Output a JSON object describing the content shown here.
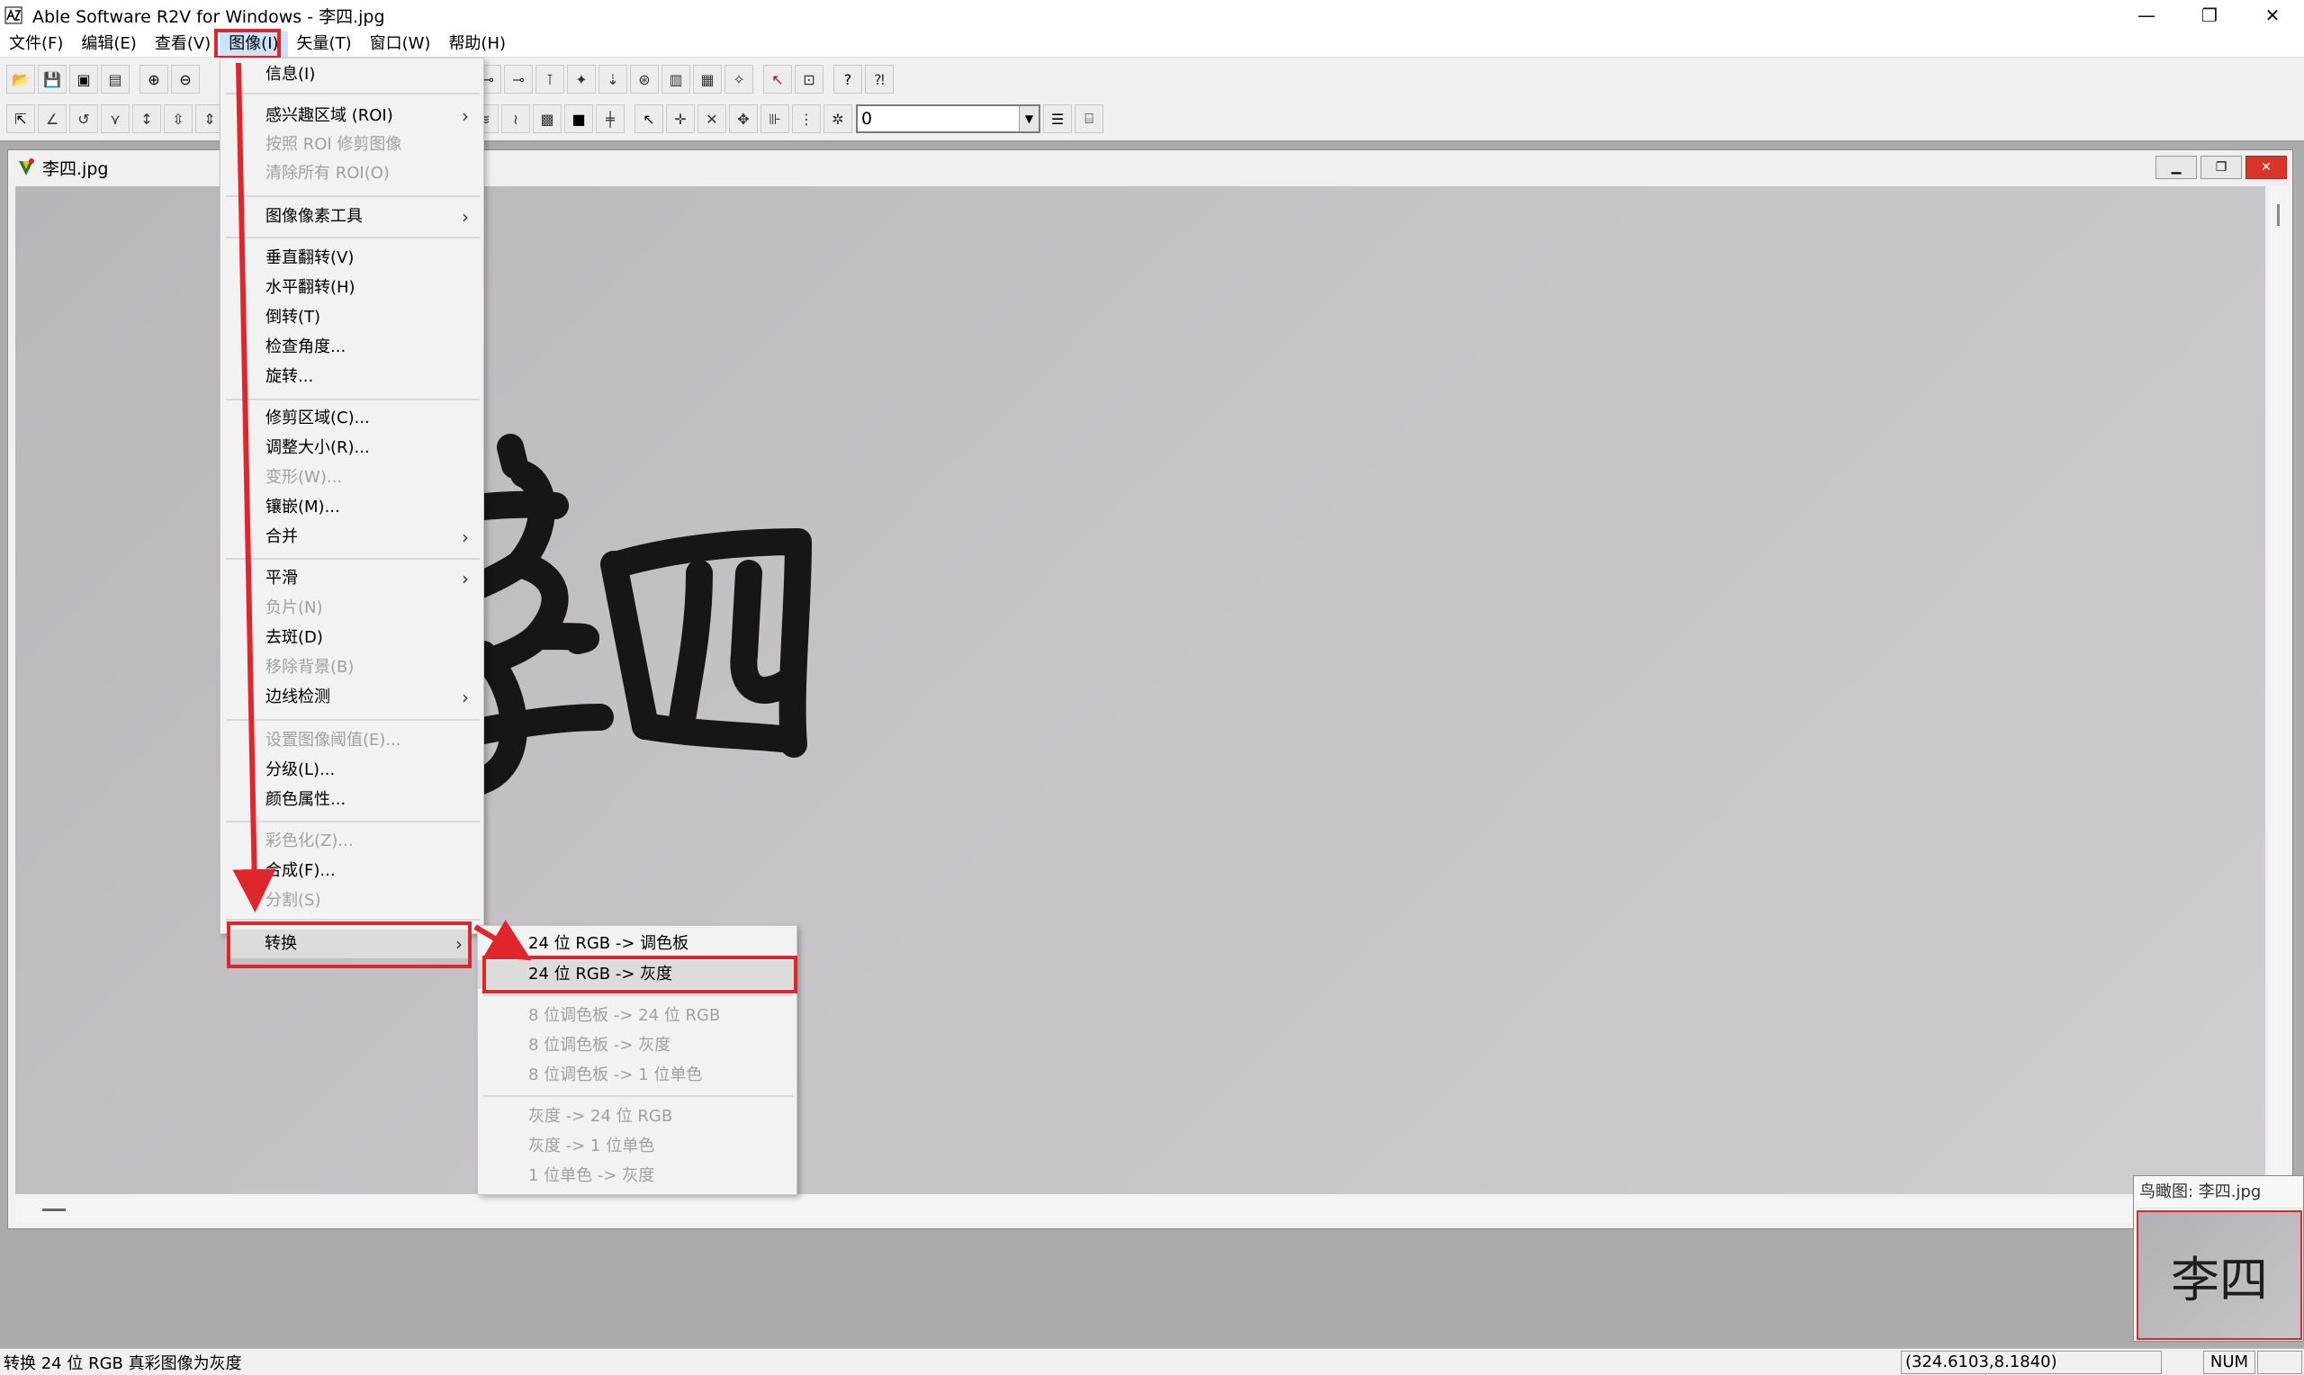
{
  "window": {
    "title": "Able Software R2V for Windows - 李四.jpg",
    "controls": {
      "minimize": "—",
      "restore": "❐",
      "close": "✕"
    }
  },
  "menubar": {
    "items": [
      "文件(F)",
      "编辑(E)",
      "查看(V)",
      "图像(I)",
      "矢量(T)",
      "窗口(W)",
      "帮助(H)"
    ],
    "active": "图像(I)"
  },
  "toolbar": {
    "row1_icons": [
      "open-icon",
      "save-icon",
      "save-all-icon",
      "print-icon",
      "zoom-in-icon",
      "zoom-out-icon"
    ],
    "line_width_value": "0"
  },
  "document": {
    "name": "李四.jpg",
    "image_text": "李四"
  },
  "image_menu": {
    "items": [
      {
        "label": "信息(I)",
        "enabled": true,
        "submenu": false
      },
      {
        "label": "感兴趣区域 (ROI)",
        "enabled": true,
        "submenu": true
      },
      {
        "label": "按照 ROI 修剪图像",
        "enabled": false,
        "submenu": false
      },
      {
        "label": "清除所有 ROI(O)",
        "enabled": false,
        "submenu": false
      },
      {
        "label": "图像像素工具",
        "enabled": true,
        "submenu": true
      },
      {
        "label": "垂直翻转(V)",
        "enabled": true,
        "submenu": false
      },
      {
        "label": "水平翻转(H)",
        "enabled": true,
        "submenu": false
      },
      {
        "label": "倒转(T)",
        "enabled": true,
        "submenu": false
      },
      {
        "label": "检查角度...",
        "enabled": true,
        "submenu": false
      },
      {
        "label": "旋转...",
        "enabled": true,
        "submenu": false
      },
      {
        "label": "修剪区域(C)...",
        "enabled": true,
        "submenu": false
      },
      {
        "label": "调整大小(R)...",
        "enabled": true,
        "submenu": false
      },
      {
        "label": "变形(W)...",
        "enabled": false,
        "submenu": false
      },
      {
        "label": "镶嵌(M)...",
        "enabled": true,
        "submenu": false
      },
      {
        "label": "合并",
        "enabled": true,
        "submenu": true
      },
      {
        "label": "平滑",
        "enabled": true,
        "submenu": true
      },
      {
        "label": "负片(N)",
        "enabled": false,
        "submenu": false
      },
      {
        "label": "去斑(D)",
        "enabled": true,
        "submenu": false
      },
      {
        "label": "移除背景(B)",
        "enabled": false,
        "submenu": false
      },
      {
        "label": "边线检测",
        "enabled": true,
        "submenu": true
      },
      {
        "label": "设置图像阈值(E)...",
        "enabled": false,
        "submenu": false
      },
      {
        "label": "分级(L)...",
        "enabled": true,
        "submenu": false
      },
      {
        "label": "颜色属性...",
        "enabled": true,
        "submenu": false
      },
      {
        "label": "彩色化(Z)...",
        "enabled": false,
        "submenu": false
      },
      {
        "label": "合成(F)...",
        "enabled": true,
        "submenu": false
      },
      {
        "label": "分割(S)",
        "enabled": false,
        "submenu": false
      },
      {
        "label": "转换",
        "enabled": true,
        "submenu": true
      }
    ],
    "submenu_arrow": "›"
  },
  "convert_submenu": {
    "items": [
      {
        "label": "24 位 RGB -> 调色板",
        "enabled": true
      },
      {
        "label": "24 位 RGB -> 灰度",
        "enabled": true
      },
      {
        "label": "8 位调色板 -> 24 位 RGB",
        "enabled": false
      },
      {
        "label": "8 位调色板 -> 灰度",
        "enabled": false
      },
      {
        "label": "8 位调色板 -> 1 位单色",
        "enabled": false
      },
      {
        "label": "灰度 -> 24 位 RGB",
        "enabled": false
      },
      {
        "label": "灰度 -> 1 位单色",
        "enabled": false
      },
      {
        "label": "1 位单色 -> 灰度",
        "enabled": false
      }
    ]
  },
  "overview": {
    "title": "鸟瞰图: 李四.jpg",
    "thumb_text": "李四"
  },
  "statusbar": {
    "message": "转换 24 位 RGB 真彩图像为灰度",
    "coords": "(324.6103,8.1840)",
    "num": "NUM"
  },
  "colors": {
    "annotation_red": "#e0262d",
    "ink": "#15151a"
  }
}
